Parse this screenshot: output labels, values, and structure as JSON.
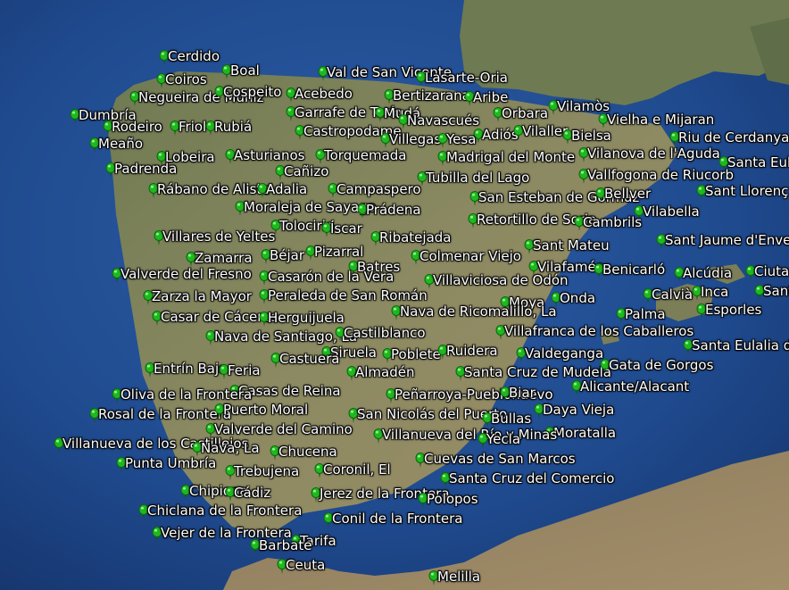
{
  "map": {
    "view": "satellite",
    "marker_color": "#1fb81f",
    "label_color": "#ffffff",
    "places": [
      "Cerdido",
      "Coiros",
      "Boal",
      "Val de San Vicente",
      "Lasarte-Oria",
      "Negueira de Muñiz",
      "Cospeito",
      "Acebedo",
      "Bertizarana",
      "Aribe",
      "Dumbría",
      "Garrafe de Torío",
      "Mudá",
      "Orbara",
      "Vilamòs",
      "Rodeiro",
      "Friol",
      "Rubiá",
      "Castropodame",
      "Navascués",
      "Adiós",
      "Vilaller",
      "Vielha e Mijaran",
      "Meaño",
      "Villegas",
      "Yesa",
      "Bielsa",
      "Riu de Cerdanya",
      "Lobeira",
      "Asturianos",
      "Torquemada",
      "Madrigal del Monte",
      "Vilanova de l'Aguda",
      "Padrenda",
      "Cañizo",
      "Tubilla del Lago",
      "Vallfogona de Riucorb",
      "Santa Eulàlia de Riu",
      "Rábano de Aliste",
      "Adalia",
      "Campaspero",
      "San Esteban de Gormaz",
      "Bellver",
      "Sant Llorenç d'Hortons",
      "Moraleja de Sayago",
      "Prádena",
      "Vilabella",
      "Tolocirio",
      "Íscar",
      "Retortillo de Soria",
      "Cambrils",
      "Villares de Yeltes",
      "Ribatejada",
      "Sant Jaume d'Enveja",
      "Zamarra",
      "Béjar",
      "Pizarral",
      "Colmenar Viejo",
      "Sant Mateu",
      "Batres",
      "Vilafamés",
      "Benicarló",
      "Alcúdia",
      "Ciutadella",
      "Valverde del Fresno",
      "Casarón de la Vera",
      "Villaviciosa de Odón",
      "Zarza la Mayor",
      "Peraleda de San Román",
      "Moya",
      "Onda",
      "Calvià",
      "Inca",
      "Sant L",
      "Casar de Cáceres",
      "Herguijuela",
      "Nava de Ricomalillo, La",
      "Palma",
      "Esporles",
      "Nava de Santiago, La",
      "Castilblanco",
      "Villafranca de los Caballeros",
      "Siruela",
      "Poblete",
      "Ruidera",
      "Valdeganga",
      "Santa Eulalia del Río",
      "Castuera",
      "Entrín Bajo",
      "Feria",
      "Almadén",
      "Santa Cruz de Mudela",
      "Gata de Gorgos",
      "Casas de Reina",
      "Alicante/Alacant",
      "Oliva de la Frontera",
      "Peñarroya-Pueblonuevo",
      "Biar",
      "Rosal de la Frontera",
      "Puerto Moral",
      "San Nicolás del Puerto",
      "Daya Vieja",
      "Bullas",
      "Valverde del Camino",
      "Moratalla",
      "Villanueva de los Castillejos",
      "Villanueva del Río y Minas",
      "Yecla",
      "Nava, La",
      "Chucena",
      "Punta Umbría",
      "Cuevas de San Marcos",
      "Trebujena",
      "Coronil, El",
      "Santa Cruz del Comercio",
      "Chipiona",
      "Cádiz",
      "Jerez de la Frontera",
      "Polopos",
      "Chiclana de la Frontera",
      "Conil de la Frontera",
      "Vejer de la Frontera",
      "Tarifa",
      "Barbate",
      "Ceuta",
      "Melilla"
    ]
  }
}
